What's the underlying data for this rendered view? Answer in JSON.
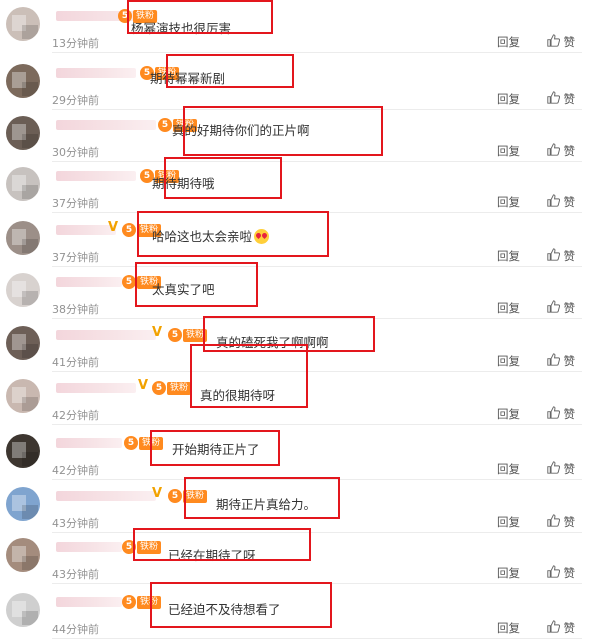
{
  "reply_label": "回复",
  "like_label": "赞",
  "fan_badge_label": "铁粉",
  "comments": [
    {
      "content": "杨幂演技也很厉害",
      "time": "13分钟前"
    },
    {
      "content": "期待幂幂新剧",
      "time": "29分钟前"
    },
    {
      "content": "真的好期待你们的正片啊",
      "time": "30分钟前"
    },
    {
      "content": "期待期待哦",
      "time": "37分钟前"
    },
    {
      "content": "哈哈这也太会亲啦",
      "time": "37分钟前",
      "emoji": "heart-eyes-emoji"
    },
    {
      "content": "太真实了吧",
      "time": "38分钟前"
    },
    {
      "content": "真的磕死我了啊啊啊",
      "time": "41分钟前"
    },
    {
      "content": "真的很期待呀",
      "time": "42分钟前"
    },
    {
      "content": "开始期待正片了",
      "time": "42分钟前"
    },
    {
      "content": "期待正片真给力。",
      "time": "43分钟前"
    },
    {
      "content": "已经在期待了呀",
      "time": "43分钟前"
    },
    {
      "content": "已经迫不及待想看了",
      "time": "44分钟前"
    }
  ],
  "colors": {
    "highlight_box": "#e3161d",
    "fan_badge": "#ff8a1f",
    "vip_v": "#f2a200",
    "time_text": "#939393"
  }
}
